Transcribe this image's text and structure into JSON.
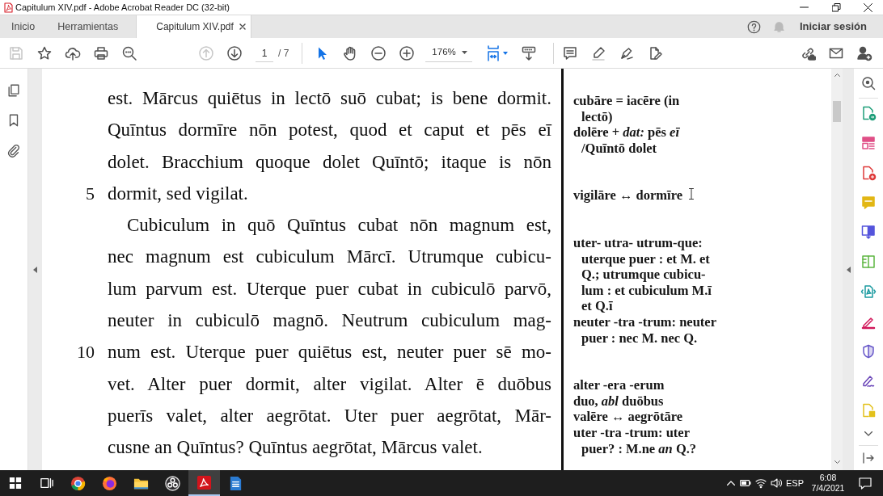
{
  "window": {
    "title": "Capitulum XIV.pdf - Adobe Acrobat Reader DC (32-bit)"
  },
  "tabs": [
    {
      "label": "Inicio",
      "kind": "nav",
      "selected": false
    },
    {
      "label": "Herramientas",
      "kind": "nav",
      "selected": false
    },
    {
      "label": "Capitulum XIV.pdf",
      "kind": "document",
      "selected": true
    }
  ],
  "account": {
    "sign_in": "Iniciar sesión"
  },
  "toolbar": {
    "file_tools": [
      {
        "kind": "save",
        "disabled": true
      },
      {
        "kind": "star",
        "disabled": false
      },
      {
        "kind": "upload",
        "disabled": false
      },
      {
        "kind": "print",
        "disabled": false
      },
      {
        "kind": "find",
        "disabled": false
      }
    ],
    "page_nav": [
      {
        "kind": "previous",
        "disabled": true
      },
      {
        "kind": "next",
        "disabled": false
      }
    ],
    "page_number": "1",
    "page_count": "/ 7",
    "pointer_tools": [
      {
        "kind": "select",
        "selected": true
      },
      {
        "kind": "hand",
        "selected": false
      }
    ],
    "zoom": "176%"
  },
  "document": {
    "paragraphs": [
      {
        "indented": false,
        "lines": [
          {
            "text": "est. Mārcus quiētus in lectō suō cubat; is bene dormit."
          },
          {
            "text": "Quīntus dormīre nōn potest, quod et caput et pēs eī"
          },
          {
            "text": "dolet. Bracchium quoque dolet Quīntō; itaque is nōn"
          },
          {
            "text": "dormit, sed vigilat.",
            "number": "5"
          }
        ]
      },
      {
        "indented": true,
        "lines": [
          {
            "text": "Cubiculum in quō Quīntus cubat nōn magnum est,"
          },
          {
            "text": "nec magnum est cubiculum Mārcī. Utrumque cubicu-"
          },
          {
            "text": "lum parvum est. Uterque puer cubat in cubiculō parvō,"
          },
          {
            "text": "neuter in cubiculō magnō. Neutrum cubiculum mag-"
          },
          {
            "text": "num est. Uterque puer quiētus est, neuter puer sē mo-",
            "number": "10"
          },
          {
            "text": "vet. Alter puer dormit, alter vigilat. Alter ē duōbus"
          },
          {
            "text": "puerīs valet, alter aegrōtat. Uter puer aegrōtat, Mār-"
          },
          {
            "text": "cusne an Quīntus? Quīntus aegrōtat, Mārcus valet."
          }
        ]
      }
    ],
    "margin_notes": [
      {
        "notes": [
          {
            "lines": [
              "cubāre = iacēre (in",
              "lectō)"
            ]
          },
          {
            "lines": [
              "dolēre + *dat:* pēs *eī*",
              "/Quīntō dolet"
            ]
          }
        ]
      },
      {
        "notes": [
          {
            "lines": [
              "vigilāre ↔ dormīre"
            ]
          }
        ]
      },
      {
        "notes": [
          {
            "lines": [
              "uter- utra- utrum-que:",
              "uterque puer : et M. et",
              "Q.; utrumque cubicu-",
              "lum : et cubiculum M.ī",
              "et Q.ī"
            ]
          },
          {
            "lines": [
              "neuter -tra -trum: neuter",
              "puer : nec M. nec Q."
            ]
          }
        ]
      },
      {
        "notes": [
          {
            "lines": [
              "alter -era -erum"
            ]
          },
          {
            "lines": [
              "duo, *abl* duōbus"
            ]
          },
          {
            "lines": [
              "valēre ↔ aegrōtāre"
            ]
          },
          {
            "lines": [
              "uter -tra -trum: uter",
              "puer? : M.ne *an* Q.?"
            ]
          }
        ]
      }
    ]
  },
  "taskbar": {
    "buttons": [
      {
        "kind": "start",
        "active": false
      },
      {
        "kind": "task_view",
        "active": false
      },
      {
        "kind": "chrome",
        "active": false
      },
      {
        "kind": "firefox",
        "active": false
      },
      {
        "kind": "explorer",
        "active": false
      },
      {
        "kind": "obs",
        "active": false
      },
      {
        "kind": "acrobat",
        "active": true
      },
      {
        "kind": "writer",
        "active": false
      }
    ],
    "language": "ESP",
    "time": "6:08",
    "date": "7/4/2021"
  }
}
